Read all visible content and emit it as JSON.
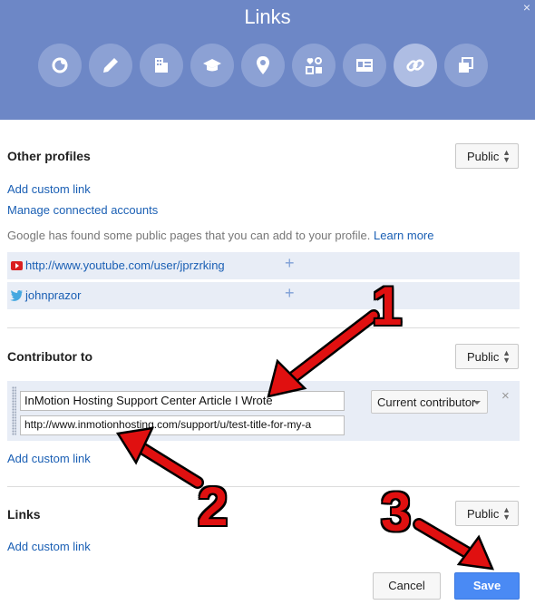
{
  "header": {
    "title": "Links",
    "close": "×"
  },
  "icons": [
    "profile-circle-icon",
    "pencil-icon",
    "building-icon",
    "graduation-cap-icon",
    "location-pin-icon",
    "relationship-icon",
    "contact-card-icon",
    "link-icon",
    "other-profiles-icon"
  ],
  "other_profiles": {
    "heading": "Other profiles",
    "visibility": "Public",
    "add_link": "Add custom link",
    "manage": "Manage connected accounts",
    "note": "Google has found some public pages that you can add to your profile.",
    "learn_more": "Learn more",
    "suggestions": [
      "http://www.youtube.com/user/jprzrking",
      "johnprazor"
    ],
    "plus": "+"
  },
  "contributor": {
    "heading": "Contributor to",
    "visibility": "Public",
    "title_value": "InMotion Hosting Support Center Article I Wrote",
    "url_value": "http://www.inmotionhosting.com/support/u/test-title-for-my-a",
    "role": "Current contributor",
    "remove": "×",
    "add_link": "Add custom link"
  },
  "links": {
    "heading": "Links",
    "visibility": "Public",
    "add_link": "Add custom link"
  },
  "footer": {
    "cancel": "Cancel",
    "save": "Save"
  },
  "annotations": [
    "1",
    "2",
    "3"
  ],
  "colors": {
    "header": "#6d87c6",
    "link": "#1a5fb4",
    "save": "#4a8af4",
    "arrow": "#e01010"
  }
}
